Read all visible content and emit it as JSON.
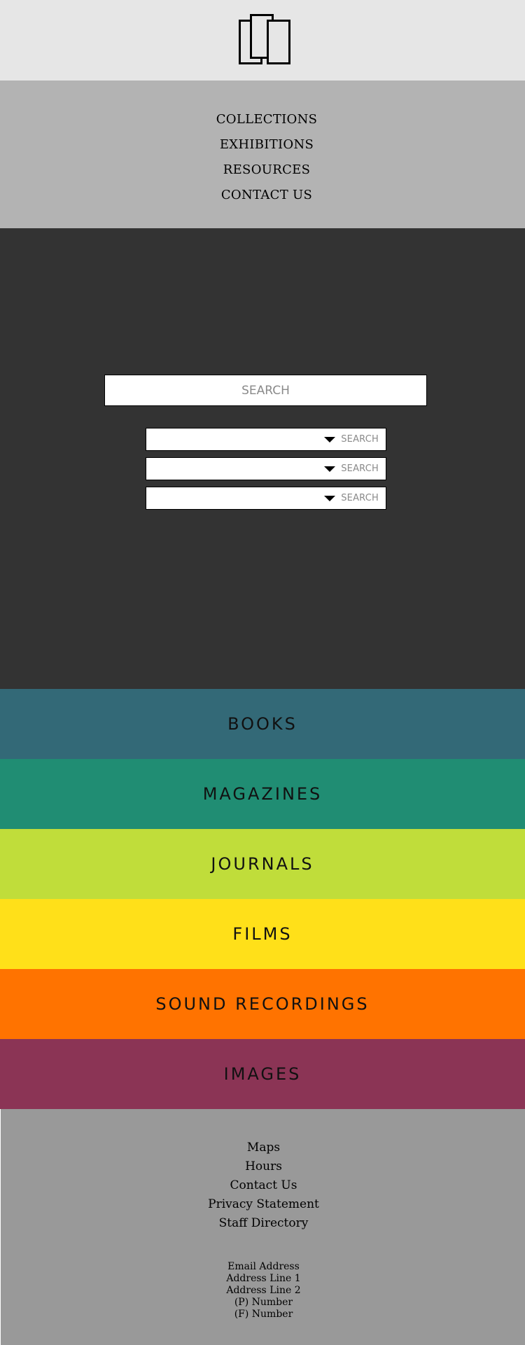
{
  "header": {
    "logo_icon": "stacked-panels-logo-icon"
  },
  "nav": {
    "items": [
      {
        "label": "COLLECTIONS"
      },
      {
        "label": "EXHIBITIONS"
      },
      {
        "label": "RESOURCES"
      },
      {
        "label": "CONTACT US"
      }
    ]
  },
  "hero": {
    "search": {
      "placeholder": "SEARCH"
    },
    "filters": [
      {
        "label": "SEARCH",
        "icon": "triangle-down-icon"
      },
      {
        "label": "SEARCH",
        "icon": "triangle-down-icon"
      },
      {
        "label": "SEARCH",
        "icon": "triangle-down-icon"
      }
    ]
  },
  "categories": [
    {
      "label": "BOOKS",
      "color": "#336977"
    },
    {
      "label": "MAGAZINES",
      "color": "#208d73"
    },
    {
      "label": "JOURNALS",
      "color": "#c0dd3a"
    },
    {
      "label": "FILMS",
      "color": "#ffe019"
    },
    {
      "label": "SOUND RECORDINGS",
      "color": "#ff7300"
    },
    {
      "label": "IMAGES",
      "color": "#8b3455"
    }
  ],
  "footer": {
    "links": [
      {
        "label": "Maps"
      },
      {
        "label": "Hours"
      },
      {
        "label": "Contact Us"
      },
      {
        "label": "Privacy Statement"
      },
      {
        "label": "Staff Directory"
      }
    ],
    "contact": [
      "Email Address",
      "Address Line 1",
      "Address Line 2",
      "(P) Number",
      "(F) Number"
    ]
  }
}
